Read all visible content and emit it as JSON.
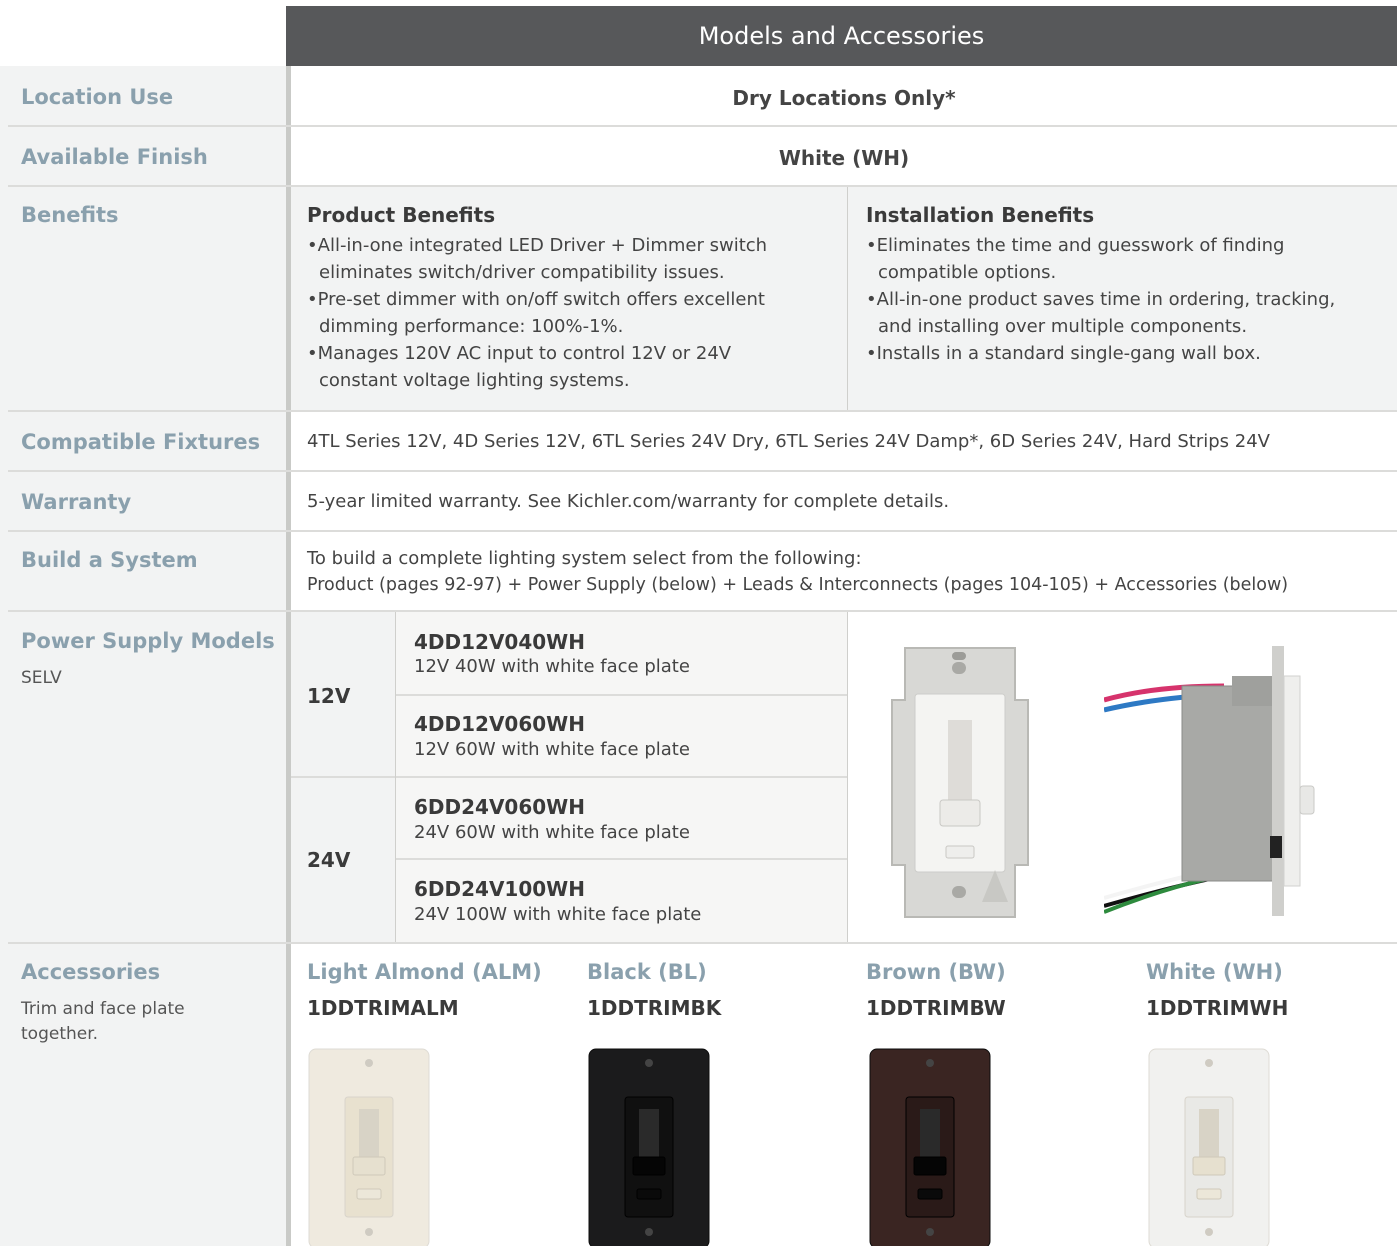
{
  "header": {
    "title": "Models and Accessories"
  },
  "rows": {
    "location": {
      "label": "Location Use",
      "value": "Dry Locations Only*"
    },
    "finish": {
      "label": "Available Finish",
      "value": "White (WH)"
    },
    "benefits": {
      "label": "Benefits",
      "product_title": "Product Benefits",
      "product_items": [
        [
          "All-in-one integrated LED Driver + Dimmer switch",
          "eliminates switch/driver compatibility issues."
        ],
        [
          "Pre-set dimmer with on/off switch offers excellent",
          "dimming performance: 100%-1%."
        ],
        [
          "Manages 120V AC input to control 12V or 24V",
          "constant voltage lighting systems."
        ]
      ],
      "install_title": "Installation Benefits",
      "install_items": [
        [
          "Eliminates the time and guesswork of finding",
          "compatible options."
        ],
        [
          "All-in-one product saves time in ordering, tracking,",
          "and installing over multiple components."
        ],
        [
          "Installs in a standard single-gang wall box.",
          ""
        ]
      ]
    },
    "fixtures": {
      "label": "Compatible Fixtures",
      "value": "4TL Series 12V, 4D Series 12V, 6TL Series 24V Dry,  6TL Series 24V Damp*, 6D Series 24V, Hard Strips 24V"
    },
    "warranty": {
      "label": "Warranty",
      "value": "5-year limited warranty. See Kichler.com/warranty for complete details."
    },
    "build": {
      "label": "Build a System",
      "line1": "To build a complete lighting system select from the following:",
      "line2": "Product (pages 92-97) + Power Supply (below) + Leads & Interconnects (pages 104-105) + Accessories (below)"
    },
    "power": {
      "label": "Power Supply Models",
      "sub": "SELV",
      "groups": [
        {
          "voltage": "12V",
          "models": [
            {
              "code": "4DD12V040WH",
              "desc": "12V 40W with white face plate"
            },
            {
              "code": "4DD12V060WH",
              "desc": "12V 60W with white face plate"
            }
          ]
        },
        {
          "voltage": "24V",
          "models": [
            {
              "code": "6DD24V060WH",
              "desc": "24V 60W with white face plate"
            },
            {
              "code": "6DD24V100WH",
              "desc": "24V 100W with white face plate"
            }
          ]
        }
      ]
    },
    "accessories": {
      "label": "Accessories",
      "sub_line1": "Trim and face plate",
      "sub_line2": "together.",
      "items": [
        {
          "color": "Light Almond (ALM)",
          "code": "1DDTRIMALM",
          "plate_color": "#efeadf",
          "slider_color": "#e8e1cf"
        },
        {
          "color": "Black (BL)",
          "code": "1DDTRIMBK",
          "plate_color": "#1b1b1c",
          "slider_color": "#101010"
        },
        {
          "color": "Brown (BW)",
          "code": "1DDTRIMBW",
          "plate_color": "#3a2522",
          "slider_color": "#2a1a18"
        },
        {
          "color": "White (WH)",
          "code": "1DDTRIMWH",
          "plate_color": "#f1f1ef",
          "slider_color": "#e9e9e6"
        }
      ]
    }
  }
}
